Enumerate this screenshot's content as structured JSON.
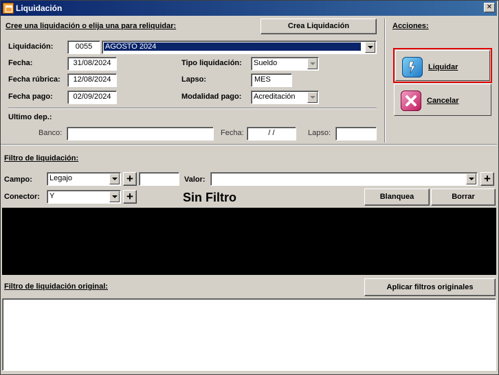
{
  "window": {
    "title": "Liquidación",
    "close_glyph": "✕"
  },
  "form": {
    "heading": "Cree una liquidación o elija una para reliquidar:",
    "create_button": "Crea Liquidación",
    "liquidacion_label": "Liquidación:",
    "liquidacion_code": "0055",
    "liquidacion_name": "AGOSTO 2024",
    "fecha_label": "Fecha:",
    "fecha_value": "31/08/2024",
    "fecha_rubrica_label": "Fecha rúbrica:",
    "fecha_rubrica_value": "12/08/2024",
    "fecha_pago_label": "Fecha pago:",
    "fecha_pago_value": "02/09/2024",
    "tipo_label": "Tipo liquidación:",
    "tipo_value": "Sueldo",
    "lapso_label": "Lapso:",
    "lapso_value": "MES",
    "modalidad_label": "Modalidad pago:",
    "modalidad_value": "Acreditación",
    "ultimo_dep_label": "Ultimo dep.:",
    "banco_label": "Banco:",
    "banco_value": "",
    "dep_fecha_label": "Fecha:",
    "dep_fecha_value": " /  /",
    "dep_lapso_label": "Lapso:",
    "dep_lapso_value": ""
  },
  "actions": {
    "heading": "Acciones:",
    "liquidar_label": "Liquidar",
    "cancelar_label": "Cancelar",
    "liquidar_icon": "lightning-icon",
    "cancelar_icon": "x-icon",
    "highlight_color": "#e00000"
  },
  "filter": {
    "heading": "Filtro de liquidación:",
    "campo_label": "Campo:",
    "campo_value": "Legajo",
    "campo_extra_value": "",
    "valor_label": "Valor:",
    "valor_value": "",
    "conector_label": "Conector:",
    "conector_value": "Y",
    "status_text": "Sin Filtro",
    "blanquea_button": "Blanquea",
    "borrar_button": "Borrar",
    "plus_glyph": "+"
  },
  "original_filter": {
    "heading": "Filtro de liquidación original:",
    "apply_button": "Aplicar filtros originales",
    "content": ""
  }
}
